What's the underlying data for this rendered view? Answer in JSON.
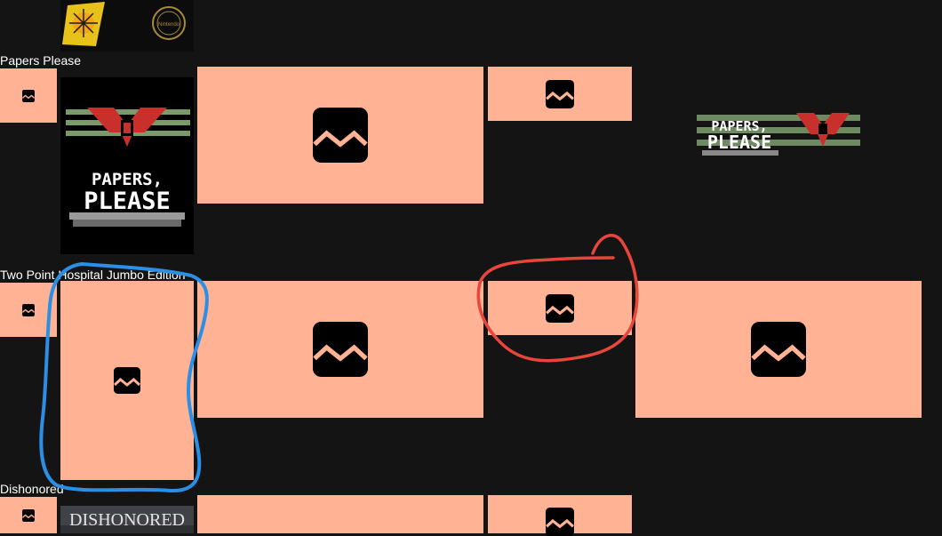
{
  "colors": {
    "background": "#141414",
    "placeholder": "#ffb294",
    "title_text": "#ffffff",
    "annotation_blue": "#2b8fe6",
    "annotation_red": "#e8463a"
  },
  "games": [
    {
      "title": "Papers Please"
    },
    {
      "title": "Two Point Hospital Jumbo Edition"
    },
    {
      "title": "Dishonored"
    }
  ],
  "artwork": {
    "papers_please_poster": {
      "line1": "PAPERS,",
      "line2": "PLEASE"
    },
    "papers_please_logo": {
      "line1": "PAPERS,",
      "line2": "PLEASE"
    },
    "dishonored_poster": {
      "text": "DISHONORED"
    },
    "top_cover": {
      "seal_text": "Nintendo"
    }
  },
  "icons": {
    "broken_image": "broken-image-icon"
  }
}
